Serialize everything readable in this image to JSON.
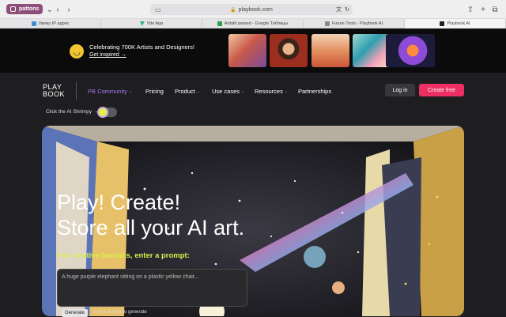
{
  "browser": {
    "profile": "pattons",
    "url": "playbook.com",
    "tabs": [
      {
        "label": "Увижу IP адрес",
        "color": "#3b8fd9"
      },
      {
        "label": "Vite App",
        "color": "#36b37e"
      },
      {
        "label": "Airtabl parsed - Google Таблицы",
        "color": "#2f9e4e"
      },
      {
        "label": "Future Tools - Playbook AI",
        "color": "#8a8a8a"
      },
      {
        "label": "Playbook AI",
        "color": "#222222"
      }
    ]
  },
  "banner": {
    "title": "Celebrating 700K Artists and Designers!",
    "link": "Get inspired →"
  },
  "nav": {
    "logo_top": "PLAY",
    "logo_bottom": "BOOK",
    "items": [
      {
        "label": "PB Community",
        "dropdown": true,
        "color": "#a877f0"
      },
      {
        "label": "Pricing",
        "dropdown": false,
        "color": "#ffffff"
      },
      {
        "label": "Product",
        "dropdown": true,
        "color": "#ffffff"
      },
      {
        "label": "Use cases",
        "dropdown": true,
        "color": "#ffffff"
      },
      {
        "label": "Resources",
        "dropdown": true,
        "color": "#ffffff"
      },
      {
        "label": "Partnerships",
        "dropdown": false,
        "color": "#ffffff"
      }
    ],
    "login": "Log in",
    "create": "Create free"
  },
  "shrimpy": {
    "label": "Click the AI Shrimpy →"
  },
  "hero": {
    "line1": "Play! Create!",
    "line2": "Store all your AI art.",
    "subtitle": "For creative humans, enter a prompt:",
    "placeholder": "A huge purple elephant sitting on a plastic yellow chair...",
    "generate": "Generate",
    "pick": "or pick a style to generate"
  },
  "colors": {
    "accent": "#ee2f63",
    "highlight": "#d9f04a",
    "community": "#a877f0"
  }
}
